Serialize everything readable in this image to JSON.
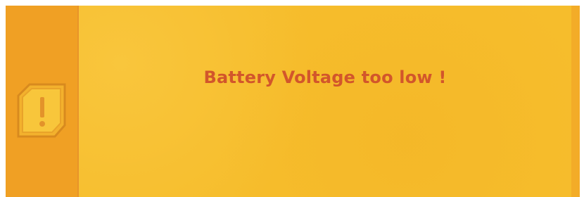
{
  "dialog": {
    "message": "Battery Voltage too low !",
    "icon": "warning-exclamation-icon"
  },
  "colors": {
    "background": "#f6bd2c",
    "sidebar": "#f0a024",
    "text": "#d2562b"
  }
}
